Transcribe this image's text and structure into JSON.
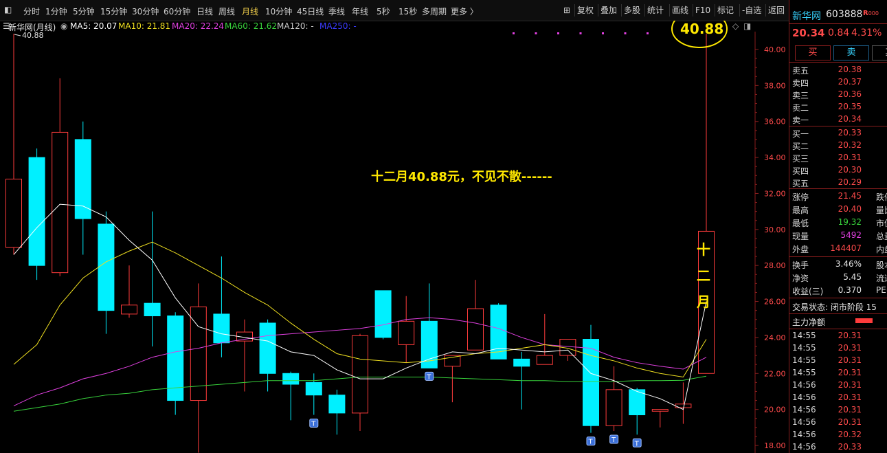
{
  "toolbar": {
    "periods": [
      "分时",
      "1分钟",
      "5分钟",
      "15分钟",
      "30分钟",
      "60分钟",
      "日线",
      "周线",
      "月线",
      "10分钟",
      "45日线",
      "季线",
      "年线",
      "5秒",
      "15秒",
      "多周期",
      "更多 〉"
    ],
    "active_period": "月线",
    "right_buttons": [
      "复权",
      "叠加",
      "多股",
      "统计",
      "画线",
      "F10",
      "标记",
      "-自选",
      "返回"
    ]
  },
  "chart_header": {
    "name": "新华网(月线)",
    "ma": [
      {
        "label": "MA5: 20.07",
        "color": "#ffffff"
      },
      {
        "label": "MA10: 21.81",
        "color": "#f0e020"
      },
      {
        "label": "MA20: 22.24",
        "color": "#e040e0"
      },
      {
        "label": "MA60: 21.62",
        "color": "#38d43c"
      },
      {
        "label": "MA120: -",
        "color": "#c8c8c8"
      },
      {
        "label": "MA250: -",
        "color": "#3a3aff"
      }
    ]
  },
  "annotations": {
    "high_label": "40.88",
    "circled_price": "40.88",
    "headline": "十二月40.88元，不见不散------",
    "vertical_text": [
      "十",
      "二",
      "月"
    ],
    "t_marker": "T"
  },
  "colors": {
    "up": "#ff3c3c",
    "down": "#00f0ff",
    "ma5": "#ffffff",
    "ma10": "#f0e020",
    "ma20": "#e040e0",
    "ma60": "#38d43c",
    "annotation": "#ffe800"
  },
  "chart_data": {
    "type": "candlestick",
    "y_ticks": [
      "40.00",
      "38.00",
      "36.00",
      "34.00",
      "32.00",
      "30.00",
      "28.00",
      "26.00",
      "24.00",
      "22.00",
      "20.00",
      "18.00"
    ],
    "ylim": [
      17.6,
      41.2
    ],
    "candles": [
      {
        "o": 29.0,
        "c": 32.8,
        "h": 40.88,
        "l": 28.6
      },
      {
        "o": 34.0,
        "c": 28.0,
        "h": 34.5,
        "l": 27.2
      },
      {
        "o": 27.6,
        "c": 35.4,
        "h": 38.4,
        "l": 27.4
      },
      {
        "o": 35.0,
        "c": 30.6,
        "h": 36.0,
        "l": 28.6
      },
      {
        "o": 30.3,
        "c": 25.5,
        "h": 31.0,
        "l": 24.2
      },
      {
        "o": 25.3,
        "c": 25.8,
        "h": 28.0,
        "l": 25.1
      },
      {
        "o": 25.9,
        "c": 25.2,
        "h": 31.0,
        "l": 23.5
      },
      {
        "o": 25.2,
        "c": 20.5,
        "h": 25.4,
        "l": 19.7
      },
      {
        "o": 20.5,
        "c": 25.7,
        "h": 27.0,
        "l": 17.6
      },
      {
        "o": 25.3,
        "c": 23.7,
        "h": 28.5,
        "l": 22.9
      },
      {
        "o": 23.8,
        "c": 24.3,
        "h": 25.0,
        "l": 21.0
      },
      {
        "o": 24.8,
        "c": 22.0,
        "h": 25.0,
        "l": 21.0
      },
      {
        "o": 22.0,
        "c": 21.4,
        "h": 22.1,
        "l": 19.4
      },
      {
        "o": 21.5,
        "c": 20.8,
        "h": 22.0,
        "l": 19.7
      },
      {
        "o": 20.8,
        "c": 19.8,
        "h": 21.1,
        "l": 18.6
      },
      {
        "o": 19.8,
        "c": 24.1,
        "h": 24.2,
        "l": 18.8
      },
      {
        "o": 26.6,
        "c": 24.0,
        "h": 26.6,
        "l": 23.9
      },
      {
        "o": 23.6,
        "c": 24.9,
        "h": 26.3,
        "l": 22.6
      },
      {
        "o": 24.9,
        "c": 22.3,
        "h": 27.0,
        "l": 22.3
      },
      {
        "o": 22.4,
        "c": 23.0,
        "h": 23.0,
        "l": 20.4
      },
      {
        "o": 23.3,
        "c": 25.6,
        "h": 27.2,
        "l": 23.3
      },
      {
        "o": 25.8,
        "c": 22.8,
        "h": 25.9,
        "l": 22.8
      },
      {
        "o": 22.8,
        "c": 22.4,
        "h": 23.2,
        "l": 20.0
      },
      {
        "o": 22.5,
        "c": 23.0,
        "h": 25.3,
        "l": 22.5
      },
      {
        "o": 23.0,
        "c": 23.9,
        "h": 23.9,
        "l": 22.7
      },
      {
        "o": 23.9,
        "c": 19.1,
        "h": 24.7,
        "l": 18.7
      },
      {
        "o": 19.1,
        "c": 21.1,
        "h": 22.4,
        "l": 18.8
      },
      {
        "o": 21.1,
        "c": 19.7,
        "h": 21.2,
        "l": 18.6
      },
      {
        "o": 19.9,
        "c": 20.0,
        "h": 20.0,
        "l": 19.0
      },
      {
        "o": 20.1,
        "c": 20.3,
        "h": 21.5,
        "l": 19.2
      },
      {
        "o": 22.0,
        "c": 29.9,
        "h": 40.88,
        "l": 22.0
      }
    ],
    "ma5": [
      28.6,
      30.1,
      31.4,
      31.3,
      30.7,
      29.4,
      28.3,
      26.2,
      24.6,
      24.2,
      24.0,
      23.8,
      23.2,
      23.0,
      22.2,
      21.7,
      21.7,
      22.3,
      22.8,
      23.2,
      23.1,
      23.4,
      23.3,
      23.2,
      23.3,
      22.0,
      21.6,
      21.0,
      20.6,
      20.0,
      26.0
    ],
    "ma10": [
      22.5,
      23.6,
      25.8,
      27.3,
      28.2,
      28.8,
      29.3,
      28.7,
      28.0,
      27.3,
      26.5,
      25.8,
      24.8,
      23.9,
      23.1,
      22.8,
      22.7,
      22.6,
      22.7,
      22.9,
      23.1,
      23.2,
      23.4,
      23.6,
      23.4,
      23.0,
      22.7,
      22.3,
      22.0,
      21.8,
      23.9
    ],
    "ma20": [
      20.2,
      20.8,
      21.2,
      21.7,
      22.0,
      22.4,
      22.9,
      23.2,
      23.4,
      23.7,
      23.9,
      24.1,
      24.2,
      24.3,
      24.4,
      24.5,
      24.7,
      25.0,
      25.1,
      25.0,
      24.8,
      24.5,
      24.0,
      23.6,
      23.5,
      23.4,
      22.9,
      22.6,
      22.4,
      22.24,
      22.9
    ],
    "ma60": [
      19.9,
      20.1,
      20.3,
      20.6,
      20.8,
      20.9,
      21.1,
      21.2,
      21.3,
      21.4,
      21.5,
      21.6,
      21.6,
      21.6,
      21.7,
      21.8,
      21.8,
      21.8,
      21.8,
      21.75,
      21.7,
      21.65,
      21.6,
      21.6,
      21.55,
      21.55,
      21.55,
      21.6,
      21.6,
      21.62,
      21.85
    ],
    "t_markers": [
      13,
      18,
      25,
      26,
      27
    ]
  },
  "quote": {
    "name": "新华网",
    "code": "603888",
    "flags": "R",
    "flags2": "000",
    "price": "20.34",
    "change": "0.84",
    "change_pct": "4.31%",
    "buy_label": "买",
    "sell_label": "卖",
    "third_label": "其",
    "asks": [
      {
        "label": "卖五",
        "price": "20.38"
      },
      {
        "label": "卖四",
        "price": "20.37"
      },
      {
        "label": "卖三",
        "price": "20.36"
      },
      {
        "label": "卖二",
        "price": "20.35"
      },
      {
        "label": "卖一",
        "price": "20.34"
      }
    ],
    "bids": [
      {
        "label": "买一",
        "price": "20.33"
      },
      {
        "label": "买二",
        "price": "20.32"
      },
      {
        "label": "买三",
        "price": "20.31"
      },
      {
        "label": "买四",
        "price": "20.30"
      },
      {
        "label": "买五",
        "price": "20.29"
      }
    ],
    "stats": [
      {
        "label": "涨停",
        "value": "21.45",
        "cls": "red",
        "label2": "跌停"
      },
      {
        "label": "最高",
        "value": "20.40",
        "cls": "red",
        "label2": "量比"
      },
      {
        "label": "最低",
        "value": "19.32",
        "cls": "green",
        "label2": "市值"
      },
      {
        "label": "现量",
        "value": "5492",
        "cls": "magenta",
        "label2": "总量"
      },
      {
        "label": "外盘",
        "value": "144407",
        "cls": "red",
        "label2": "内盘"
      }
    ],
    "stats2": [
      {
        "label": "换手",
        "value": "3.46%",
        "label2": "股本"
      },
      {
        "label": "净资",
        "value": "5.45",
        "label2": "流通"
      },
      {
        "label": "收益(三)",
        "value": "0.370",
        "label2": "PE("
      }
    ],
    "trade_status": "交易状态: 闭市阶段 15",
    "main_net_label": "主力净额",
    "ticks": [
      {
        "time": "14:55",
        "price": "20.31"
      },
      {
        "time": "14:55",
        "price": "20.31"
      },
      {
        "time": "14:55",
        "price": "20.31"
      },
      {
        "time": "14:55",
        "price": "20.31"
      },
      {
        "time": "14:56",
        "price": "20.31"
      },
      {
        "time": "14:56",
        "price": "20.31"
      },
      {
        "time": "14:56",
        "price": "20.31"
      },
      {
        "time": "14:56",
        "price": "20.31"
      },
      {
        "time": "14:56",
        "price": "20.32"
      },
      {
        "time": "14:56",
        "price": "20.33"
      }
    ]
  }
}
